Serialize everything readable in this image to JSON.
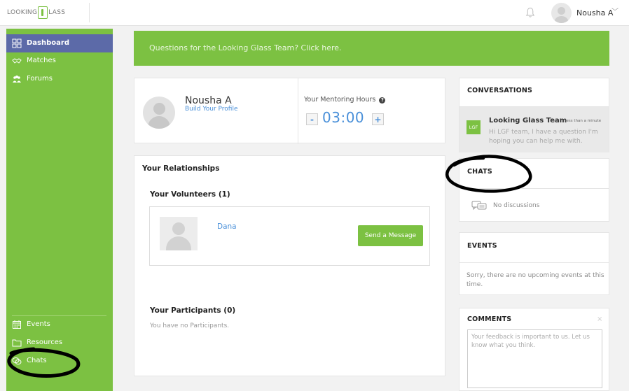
{
  "header": {
    "logo_left": "LOOKING",
    "logo_right": "LASS",
    "username": "Nousha A"
  },
  "sidebar": {
    "items": [
      {
        "label": "Dashboard",
        "icon": "dashboard-grid-icon",
        "active": true
      },
      {
        "label": "Matches",
        "icon": "handshake-icon",
        "active": false
      },
      {
        "label": "Forums",
        "icon": "people-group-icon",
        "active": false
      },
      {
        "label": "Events",
        "icon": "calendar-icon",
        "active": false
      },
      {
        "label": "Resources",
        "icon": "folder-icon",
        "active": false
      },
      {
        "label": "Chats",
        "icon": "chat-bubbles-icon",
        "active": false
      }
    ]
  },
  "banner": {
    "text": "Questions for the Looking Glass Team? Click here."
  },
  "profile": {
    "name": "Nousha A",
    "build_link": "Build Your Profile",
    "hours_label": "Your Mentoring Hours",
    "hours_help_icon": "question-circle-icon",
    "minus_label": "-",
    "plus_label": "+",
    "hours_value": "03:00"
  },
  "relationships": {
    "title": "Your Relationships",
    "volunteers_title": "Your Volunteers (1)",
    "volunteers": [
      {
        "name": "Dana",
        "button": "Send a Message"
      }
    ],
    "participants_title": "Your Participants (0)",
    "participants_empty": "You have no Participants."
  },
  "conversations": {
    "title": "CONVERSATIONS",
    "items": [
      {
        "badge": "LGF",
        "name": "Looking Glass Team",
        "time": "less than a minute",
        "preview": "Hi LGF team, I have a question I'm hoping you can help me with."
      }
    ]
  },
  "chats": {
    "title": "CHATS",
    "empty": "No discussions"
  },
  "events": {
    "title": "EVENTS",
    "empty": "Sorry, there are no upcoming events at this time."
  },
  "comments": {
    "title": "COMMENTS",
    "close": "×",
    "placeholder": "Your feedback is important to us. Let us know what you think."
  },
  "colors": {
    "brand_green": "#7cc142",
    "active_nav": "#5c6aa8",
    "link_blue": "#4a90d9"
  }
}
